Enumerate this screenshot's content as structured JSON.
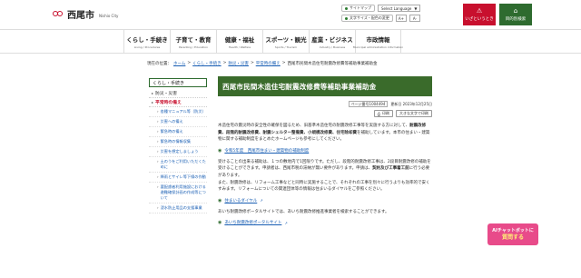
{
  "header": {
    "city_name": "西尾市",
    "city_en": "Nishio City",
    "sitemap": "サイトマップ",
    "language": "Select Language",
    "language_arrow": "▼",
    "font_size_label": "文字サイズ・配色の変更",
    "emergency": "いざというとき",
    "emergency_icon": "⚠",
    "facilities": "目的別検索",
    "facilities_icon": "⌂"
  },
  "gnav": [
    {
      "jp": "くらし・手続き",
      "en": "Living / Procedures"
    },
    {
      "jp": "子育て・教育",
      "en": "Parenting / Education"
    },
    {
      "jp": "健康・福祉",
      "en": "Health / Welfare"
    },
    {
      "jp": "スポーツ・観光",
      "en": "Sports / Tourism"
    },
    {
      "jp": "産業・ビジネス",
      "en": "Industry / Business"
    },
    {
      "jp": "市政情報",
      "en": "Municipal administration information"
    }
  ],
  "breadcrumb": {
    "prefix": "現在の位置：",
    "items": [
      "ホーム",
      "くらし・手続き",
      "防災・災害",
      "平常時の備え"
    ],
    "current": "西尾市民間木造住宅耐震改修費等補助事業補助金",
    "sep": ">"
  },
  "sidebar": {
    "heading": "くらし・手続き",
    "items": [
      {
        "label": "防災・災害",
        "level": 1,
        "active": false
      },
      {
        "label": "平常時の備え",
        "level": 1,
        "active": true
      },
      {
        "label": "各種マニュアル等（防災）",
        "level": 2
      },
      {
        "label": "災害への備え",
        "level": 2
      },
      {
        "label": "緊急時の備え",
        "level": 2
      },
      {
        "label": "緊急時の情報収集",
        "level": 2
      },
      {
        "label": "災害を想定しましょう",
        "level": 2
      },
      {
        "label": "土のうをご利用いただくために",
        "level": 2
      },
      {
        "label": "降雨とサイレ等下線の作動",
        "level": 2
      },
      {
        "label": "要配慮者利用施設における避難確保計画の作成等について",
        "level": 2
      },
      {
        "label": "浸水防止用品の支援事業",
        "level": 2
      }
    ]
  },
  "main": {
    "title": "西尾市民間木造住宅耐震改修費等補助事業補助金",
    "page_number": "ページ番号1004494",
    "updated": "更新日 2023年12月25日",
    "print": "印刷",
    "large_print": "大きな文字で印刷",
    "para1_a": "木造住宅の震災時の安全性の確保を図るため、旧基準木造住宅の耐震改修工事等を実施する方に対して、",
    "para1_b": "耐震改修費、段階的耐震改修費、耐震シェルター整備費、小規模改修費、住宅除却費",
    "para1_c": "を補助しています。本市の住まい・建築物に関する補助制度をまとめたホームページも参考にしてください。",
    "link1": "令和5年度　西尾市住まい・建築物の補助制度",
    "para2_a": "受けることの出来る補助は、１つの敷地内で1回限りです。ただし、段階的耐震改修工事は、2段目耐震改修の補助を受けることができます。申請者は、西尾市税の滞納が無い要件があります。申請は、",
    "para2_b": "契約及び工事着工前",
    "para2_c": "に行う必要があります。",
    "para3": "また、耐震改修は、リフォーム工事などと同時に実施することで、それぞれの工事を別々に行うよりも効率的で安くすみます。リフォームについての関連団体等の情報は住まいるダイヤルをご参照ください。",
    "link2": "住まいるダイヤル",
    "para4": "あいち耐震改修ポータルサイトでは、あいち耐震改修推進事業者を検索することができます。",
    "link3": "あいち耐震改修ポータルサイト",
    "ext_label": "（外部リンク）"
  },
  "chatbot": {
    "line1": "AIチャットボットに",
    "line2": "質問する"
  }
}
